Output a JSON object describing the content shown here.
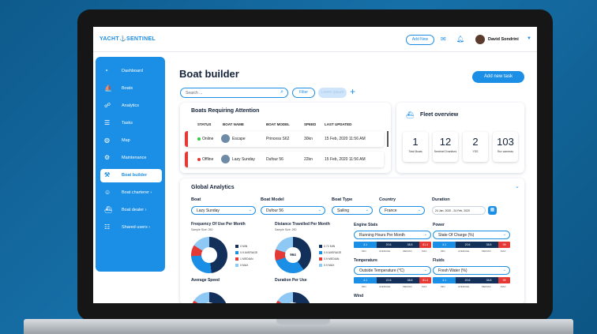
{
  "brand": {
    "logo": "YACHT⚓SENTINEL"
  },
  "topbar": {
    "add_new": "Add New",
    "user_name": "David Sondrini"
  },
  "sidebar": {
    "items": [
      {
        "label": "Dashboard",
        "icon": "speedometer-icon"
      },
      {
        "label": "Boats",
        "icon": "boat-icon"
      },
      {
        "label": "Analytics",
        "icon": "analytics-icon"
      },
      {
        "label": "Tasks",
        "icon": "tasks-icon"
      },
      {
        "label": "Map",
        "icon": "globe-icon"
      },
      {
        "label": "Maintenance",
        "icon": "wrench-icon"
      },
      {
        "label": "Boat builder",
        "icon": "builder-icon",
        "active": true
      },
      {
        "label": "Boat charterer ›",
        "icon": "user-icon"
      },
      {
        "label": "Boat dealer ›",
        "icon": "dealer-icon"
      },
      {
        "label": "Shared users ›",
        "icon": "users-icon"
      }
    ]
  },
  "page": {
    "title": "Boat builder",
    "add_task": "Add new task",
    "search_placeholder": "Search ...",
    "filter": "Filter",
    "filter_pill": "Lorem ipsum"
  },
  "attention": {
    "title": "Boats Requiring Attention",
    "headers": [
      "STATUS",
      "BOAT NAME",
      "BOAT MODEL",
      "SPEED",
      "LAST UPDATED"
    ],
    "rows": [
      {
        "status": "Online",
        "name": "Escape",
        "model": "Princess S62",
        "speed": "30kn",
        "updated": "15 Feb, 2020 11:56 AM",
        "status_color": "#2ecc40"
      },
      {
        "status": "Offline",
        "name": "Lazy Sunday",
        "model": "Dufour 56",
        "speed": "22kn",
        "updated": "15 Feb, 2020 11:56 AM",
        "status_color": "#e53935"
      }
    ]
  },
  "fleet": {
    "title": "Fleet overview",
    "stats": [
      {
        "value": "1",
        "label": "Total Boats"
      },
      {
        "value": "12",
        "label": "Sentinel Dvanitors"
      },
      {
        "value": "2",
        "label": "YSS"
      },
      {
        "value": "103",
        "label": "Rur cameras"
      }
    ]
  },
  "global": {
    "title": "Global Analytics",
    "filters": {
      "boat": {
        "label": "Boat",
        "value": "Lazy Sunday"
      },
      "model": {
        "label": "Boat Model",
        "value": "Dufour 56"
      },
      "type": {
        "label": "Boat Type",
        "value": "Sailing"
      },
      "country": {
        "label": "Country",
        "value": "France"
      },
      "duration": {
        "label": "Duration",
        "value": "24 Jan, 2020 - 24 Feb, 2020"
      }
    },
    "freq": {
      "title": "Frequency Of Use Per Month",
      "sub": "Sample Size: 250",
      "legend": [
        "0 MIN",
        "0.9 AVERAGE",
        "1 MEDIAN",
        "0 MAX"
      ]
    },
    "dist": {
      "title": "Distance Travelled Per Month",
      "sub": "Sample Size: 250",
      "center": "964",
      "legend": [
        "0.72 MIN",
        "0.9 AVERAGE",
        "0.9 MEDIAN",
        "0.9 MAX"
      ]
    },
    "avgspeed": {
      "title": "Average Speed"
    },
    "durpu": {
      "title": "Duration Per Use"
    },
    "engine": {
      "title": "Engine Stats",
      "select": "Running Hours Per Month"
    },
    "power": {
      "title": "Power",
      "select": "State Of Charge (%)"
    },
    "temp": {
      "title": "Temperature",
      "select": "Outside Temperature (°C)"
    },
    "fluids": {
      "title": "Fluids",
      "select": "Fresh Water (%)"
    },
    "wind": {
      "title": "Wind"
    },
    "gauge_labels": [
      "MIN",
      "AVERAGE",
      "MEDIAN",
      "MAX"
    ],
    "gauges": {
      "engine": [
        "4.1",
        "20.6",
        "38.8",
        "81.4"
      ],
      "power": [
        "4.1",
        "20.6",
        "38.8",
        "95"
      ],
      "temp": [
        "4.1",
        "22.6",
        "38.8",
        "81.4"
      ],
      "fluids": [
        "4.1",
        "20.6",
        "38.8",
        "95"
      ]
    }
  },
  "colors": {
    "accent": "#1b8fe6",
    "navy": "#14233a",
    "danger": "#e53935"
  }
}
